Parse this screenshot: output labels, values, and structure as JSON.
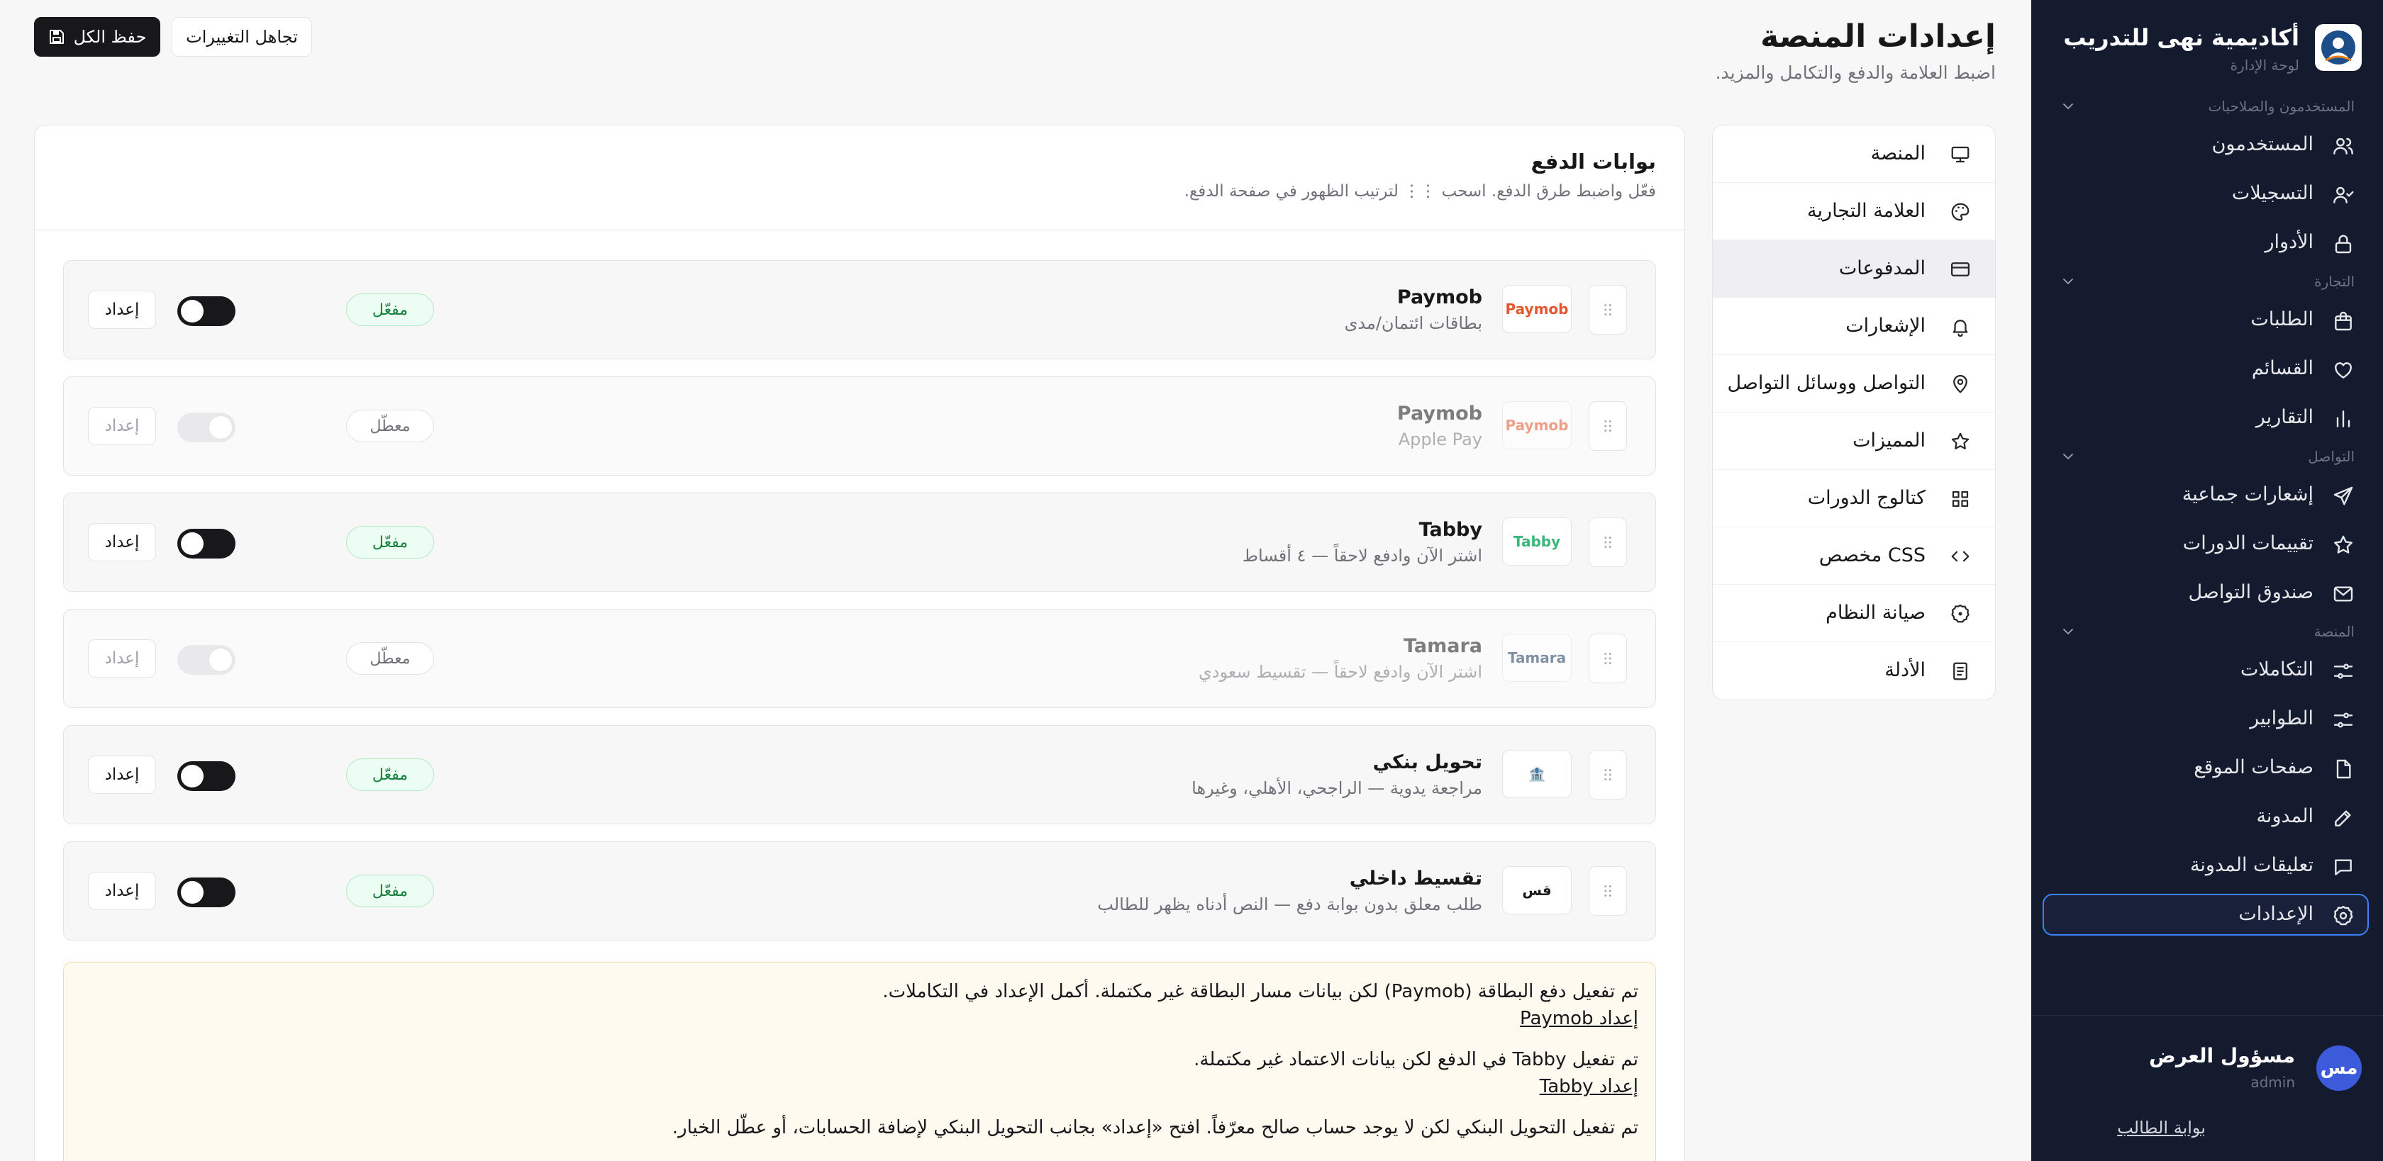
{
  "brand": {
    "name": "أكاديمية نهى للتدريب",
    "subtitle": "لوحة الإدارة"
  },
  "sidebar": {
    "groups": [
      {
        "label": "المستخدمون والصلاحيات",
        "items": [
          {
            "label": "المستخدمون",
            "icon": "users-icon"
          },
          {
            "label": "التسجيلات",
            "icon": "user-check-icon"
          },
          {
            "label": "الأدوار",
            "icon": "lock-icon"
          }
        ]
      },
      {
        "label": "التجارة",
        "items": [
          {
            "label": "الطلبات",
            "icon": "shopping-bag-icon"
          },
          {
            "label": "القسائم",
            "icon": "heart-icon"
          },
          {
            "label": "التقارير",
            "icon": "bar-chart-icon"
          }
        ]
      },
      {
        "label": "التواصل",
        "items": [
          {
            "label": "إشعارات جماعية",
            "icon": "send-icon"
          },
          {
            "label": "تقييمات الدورات",
            "icon": "star-icon"
          },
          {
            "label": "صندوق التواصل",
            "icon": "mail-icon"
          }
        ]
      },
      {
        "label": "المنصة",
        "items": [
          {
            "label": "التكاملات",
            "icon": "sliders-icon"
          },
          {
            "label": "الطوابير",
            "icon": "sliders-icon"
          },
          {
            "label": "صفحات الموقع",
            "icon": "file-icon"
          },
          {
            "label": "المدونة",
            "icon": "edit-icon"
          },
          {
            "label": "تعليقات المدونة",
            "icon": "message-icon"
          },
          {
            "label": "الإعدادات",
            "icon": "settings-icon",
            "active": true
          }
        ]
      }
    ],
    "user": {
      "initials": "مس",
      "name": "مسؤول العرض",
      "role": "admin"
    },
    "portal_link": "بوابة الطالب"
  },
  "header": {
    "title": "إعدادات المنصة",
    "subtitle": "اضبط العلامة والدفع والتكامل والمزيد.",
    "save_label": "حفظ الكل",
    "discard_label": "تجاهل التغييرات"
  },
  "settings_nav": [
    {
      "label": "المنصة",
      "icon": "monitor-icon"
    },
    {
      "label": "العلامة التجارية",
      "icon": "palette-icon"
    },
    {
      "label": "المدفوعات",
      "icon": "credit-card-icon",
      "active": true
    },
    {
      "label": "الإشعارات",
      "icon": "bell-icon"
    },
    {
      "label": "التواصل ووسائل التواصل",
      "icon": "map-pin-icon"
    },
    {
      "label": "المميزات",
      "icon": "star-icon"
    },
    {
      "label": "كتالوج الدورات",
      "icon": "grid-icon"
    },
    {
      "label": "CSS مخصص",
      "icon": "code-icon"
    },
    {
      "label": "صيانة النظام",
      "icon": "wrench-icon"
    },
    {
      "label": "الأدلة",
      "icon": "book-icon"
    }
  ],
  "payments": {
    "title": "بوابات الدفع",
    "subtitle": "فعّل واضبط طرق الدفع. اسحب ⋮⋮ لترتيب الظهور في صفحة الدفع.",
    "setup_label": "إعداد",
    "gateways": [
      {
        "name": "Paymob",
        "desc": "بطاقات ائتمان/مدى",
        "logo": "Paymob",
        "logo_color": "#e4572e",
        "status": "مفعّل",
        "enabled": true
      },
      {
        "name": "Paymob",
        "desc": "Apple Pay",
        "logo": "Paymob",
        "logo_color": "#e4572e",
        "status": "معطّل",
        "enabled": false
      },
      {
        "name": "Tabby",
        "desc": "اشتر الآن وادفع لاحقاً — ٤ أقساط",
        "logo": "Tabby",
        "logo_color": "#3bb77e",
        "status": "مفعّل",
        "enabled": true
      },
      {
        "name": "Tamara",
        "desc": "اشتر الآن وادفع لاحقاً — تقسيط سعودي",
        "logo": "Tamara",
        "logo_color": "#1e3a5f",
        "status": "معطّل",
        "enabled": false
      },
      {
        "name": "تحويل بنكي",
        "desc": "مراجعة يدوية — الراجحي، الأهلي، وغيرها",
        "logo": "🏦",
        "logo_color": "#18181b",
        "status": "مفعّل",
        "enabled": true
      },
      {
        "name": "تقسيط داخلي",
        "desc": "طلب معلق بدون بوابة دفع — النص أدناه يظهر للطالب",
        "logo": "قس",
        "logo_color": "#18181b",
        "status": "مفعّل",
        "enabled": true
      }
    ],
    "warnings": {
      "paymob_text": "تم تفعيل دفع البطاقة (Paymob) لكن بيانات مسار البطاقة غير مكتملة. أكمل الإعداد في التكاملات.",
      "paymob_link": "إعداد Paymob",
      "tabby_text": "تم تفعيل Tabby في الدفع لكن بيانات الاعتماد غير مكتملة.",
      "tabby_link": "إعداد Tabby",
      "bank_text": "تم تفعيل التحويل البنكي لكن لا يوجد حساب صالح معرّفاً. افتح «إعداد» بجانب التحويل البنكي لإضافة الحسابات، أو عطّل الخيار."
    }
  }
}
